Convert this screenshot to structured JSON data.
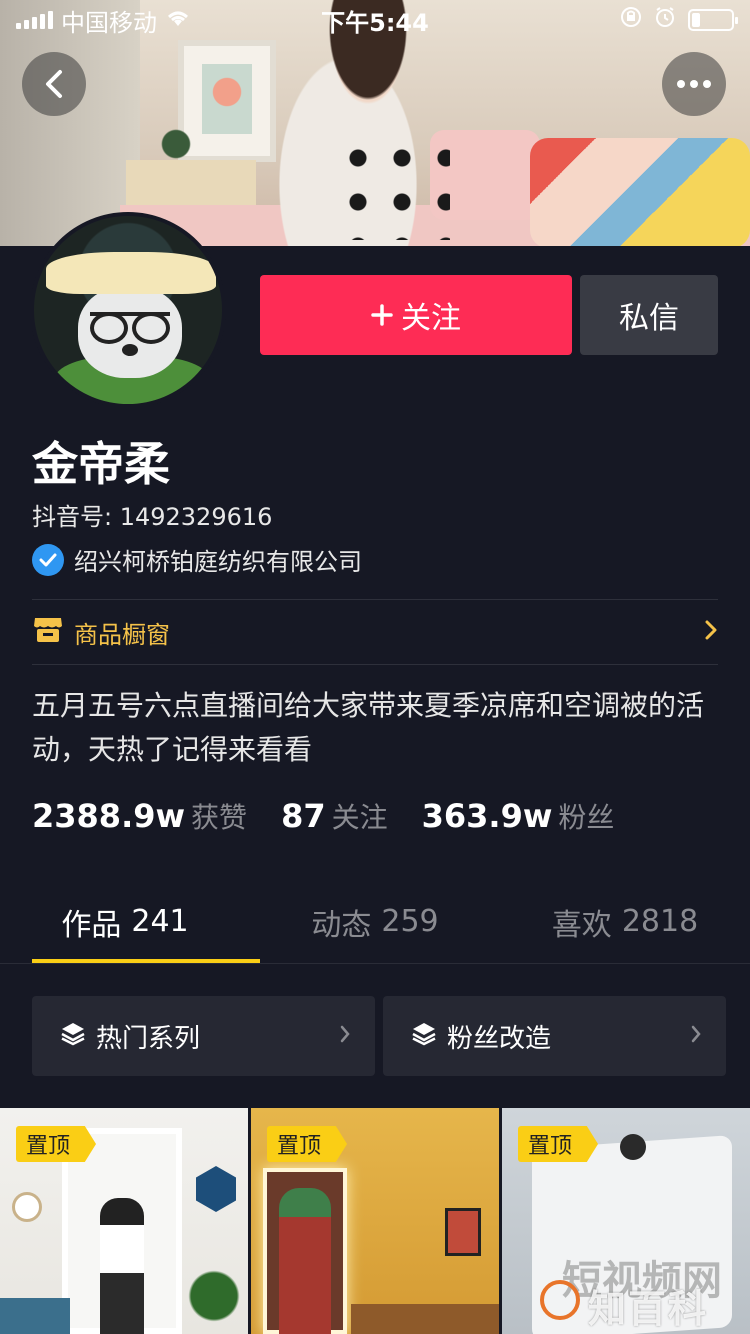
{
  "status_bar": {
    "carrier": "中国移动",
    "time": "下午5:44"
  },
  "profile": {
    "name": "金帝柔",
    "douyin_id": "抖音号: 1492329616",
    "verified_org": "绍兴柯桥铂庭纺织有限公司",
    "shop_window": "商品橱窗",
    "bio": "五月五号六点直播间给大家带来夏季凉席和空调被的活动，天热了记得来看看"
  },
  "actions": {
    "follow": "关注",
    "message": "私信"
  },
  "stats": [
    {
      "value": "2388.9w",
      "label": "获赞"
    },
    {
      "value": "87",
      "label": "关注"
    },
    {
      "value": "363.9w",
      "label": "粉丝"
    }
  ],
  "tabs": [
    {
      "label": "作品",
      "count": "241"
    },
    {
      "label": "动态",
      "count": "259"
    },
    {
      "label": "喜欢",
      "count": "2818"
    }
  ],
  "series": [
    {
      "label": "热门系列"
    },
    {
      "label": "粉丝改造"
    }
  ],
  "videos": [
    {
      "badge": "置顶"
    },
    {
      "badge": "置顶"
    },
    {
      "badge": "置顶"
    }
  ],
  "watermark": {
    "back": "短视频网",
    "front": "知百科"
  },
  "colors": {
    "background": "#161824",
    "follow_button": "#fe2c55",
    "accent_yellow": "#face15",
    "shop_text": "#f5c249",
    "verified_blue": "#2f97f2"
  },
  "battery_level": 0.22,
  "active_tab": "作品"
}
